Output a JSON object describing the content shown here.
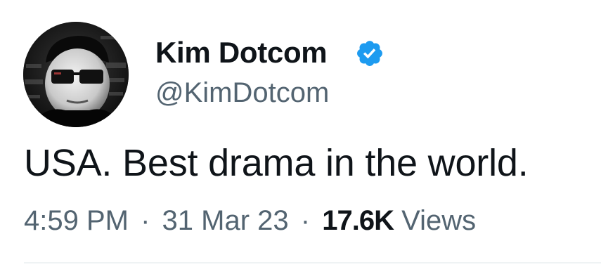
{
  "author": {
    "display_name": "Kim Dotcom",
    "handle": "@KimDotcom",
    "verified": true,
    "avatar_icon": "profile-photo"
  },
  "tweet": {
    "text": "USA. Best drama in the world."
  },
  "meta": {
    "time": "4:59 PM",
    "separator": "·",
    "date": "31 Mar 23",
    "views_count": "17.6K",
    "views_label": "Views"
  },
  "colors": {
    "text_primary": "#0f1419",
    "text_secondary": "#536471",
    "verified_blue": "#1d9bf0",
    "divider": "#eff3f4"
  }
}
